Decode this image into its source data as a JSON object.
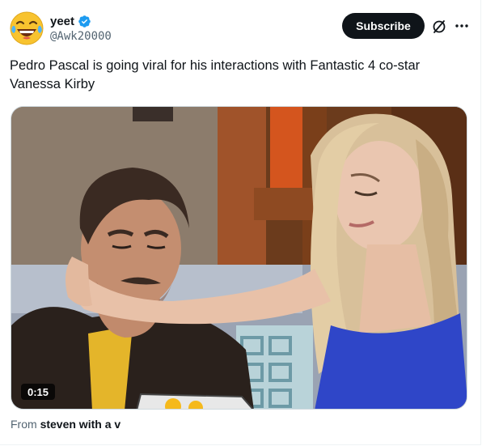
{
  "author": {
    "display_name": "yeet",
    "handle": "@Awk20000",
    "avatar_icon": "laughing-crying-emoji",
    "verified": true,
    "verified_color": "#1d9bf0"
  },
  "header": {
    "subscribe_label": "Subscribe",
    "grok_icon": "grok-icon",
    "more_icon": "more-icon"
  },
  "tweet": {
    "text": "Pedro Pascal is going viral for his interactions with Fantastic 4 co-star Vanessa Kirby"
  },
  "media": {
    "type": "video",
    "duration": "0:15"
  },
  "source": {
    "prefix": "From",
    "name": "steven with a v"
  },
  "colors": {
    "text_primary": "#0f1419",
    "text_secondary": "#536471",
    "button_bg": "#0f1419",
    "border": "#cfd9de"
  }
}
